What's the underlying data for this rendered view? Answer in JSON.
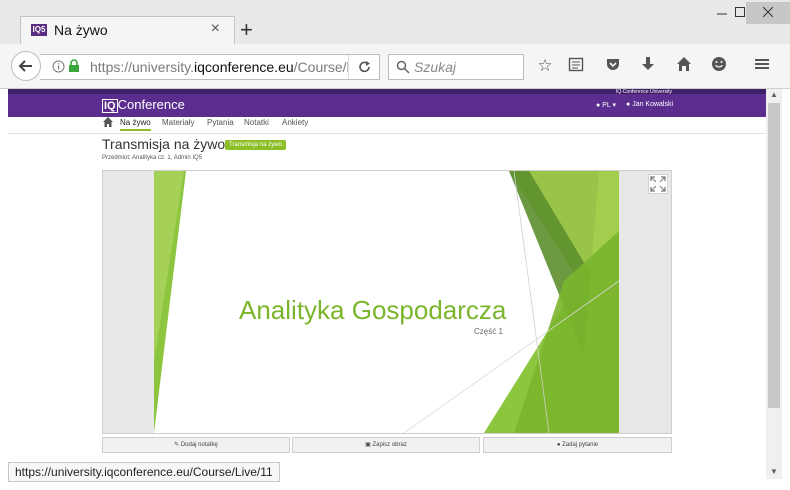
{
  "browser": {
    "tab_title": "Na żywo",
    "tab_favicon_text": "IQ5",
    "new_tab_symbol": "+",
    "close_tab_symbol": "×",
    "url_prefix": "https://university.",
    "url_domain": "iqconference.eu",
    "url_path": "/Course/l",
    "search_placeholder": "Szukaj",
    "status_url": "https://university.iqconference.eu/Course/Live/11"
  },
  "site": {
    "logo_iq": "IQ",
    "logo_name": "Conference",
    "header_small": "IQ-Conference University",
    "language": "PL",
    "user": "Jan Kowalski",
    "nav": [
      {
        "label": "Na żywo"
      },
      {
        "label": "Materiały"
      },
      {
        "label": "Pytania"
      },
      {
        "label": "Notatki"
      },
      {
        "label": "Ankiety"
      }
    ]
  },
  "main": {
    "title": "Transmisja na żywo",
    "badge": "Transmisja na żywo",
    "meta": "Przedmiot: Analityka cz. 1, Admin IQ5",
    "slide_title": "Analityka Gospodarcza",
    "slide_subtitle": "Część 1",
    "actions": {
      "add_note": "Dodaj notatkę",
      "save_image": "Zapisz obraz",
      "ask_question": "Zadaj pytanie"
    }
  },
  "colors": {
    "header_purple": "#5b2d8e",
    "accent_green": "#8cbf26",
    "slide_green": "#7ab52c"
  }
}
